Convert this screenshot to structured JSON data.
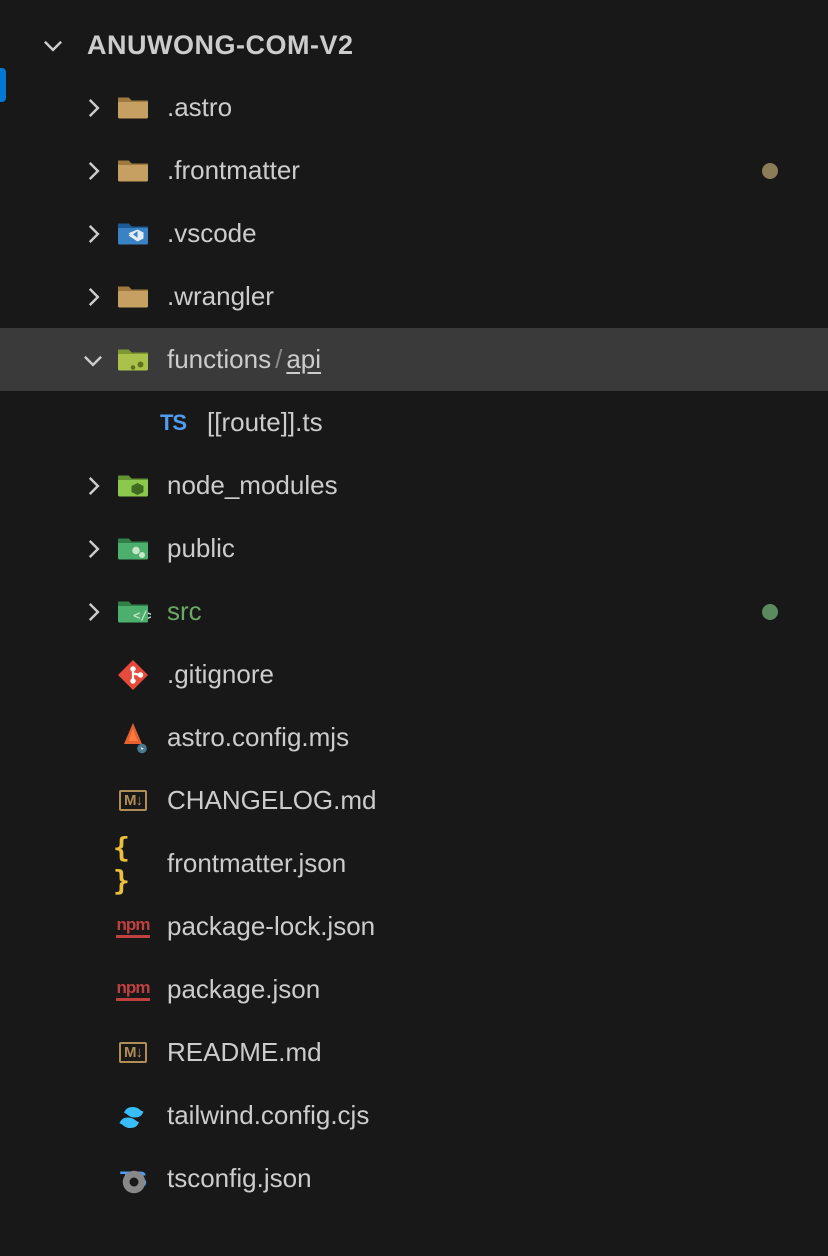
{
  "root": {
    "name": "ANUWONG-COM-V2",
    "expanded": true
  },
  "tree": [
    {
      "type": "folder",
      "name": ".astro",
      "expanded": false,
      "icon": "folder-tan"
    },
    {
      "type": "folder",
      "name": ".frontmatter",
      "expanded": false,
      "icon": "folder-tan",
      "status": "olive"
    },
    {
      "type": "folder",
      "name": ".vscode",
      "expanded": false,
      "icon": "folder-vscode"
    },
    {
      "type": "folder",
      "name": ".wrangler",
      "expanded": false,
      "icon": "folder-tan"
    },
    {
      "type": "folder-path",
      "parts": [
        "functions",
        "api"
      ],
      "expanded": true,
      "icon": "folder-functions",
      "selected": true,
      "children": [
        {
          "type": "file",
          "name": "[[route]].ts",
          "icon": "ts"
        }
      ]
    },
    {
      "type": "folder",
      "name": "node_modules",
      "expanded": false,
      "icon": "folder-node"
    },
    {
      "type": "folder",
      "name": "public",
      "expanded": false,
      "icon": "folder-public"
    },
    {
      "type": "folder",
      "name": "src",
      "expanded": false,
      "icon": "folder-src",
      "labelColor": "green",
      "status": "green"
    },
    {
      "type": "file",
      "name": ".gitignore",
      "icon": "git"
    },
    {
      "type": "file",
      "name": "astro.config.mjs",
      "icon": "astro"
    },
    {
      "type": "file",
      "name": "CHANGELOG.md",
      "icon": "md"
    },
    {
      "type": "file",
      "name": "frontmatter.json",
      "icon": "json-curly"
    },
    {
      "type": "file",
      "name": "package-lock.json",
      "icon": "npm"
    },
    {
      "type": "file",
      "name": "package.json",
      "icon": "npm"
    },
    {
      "type": "file",
      "name": "README.md",
      "icon": "md"
    },
    {
      "type": "file",
      "name": "tailwind.config.cjs",
      "icon": "tailwind"
    },
    {
      "type": "file",
      "name": "tsconfig.json",
      "icon": "ts-gear"
    }
  ]
}
